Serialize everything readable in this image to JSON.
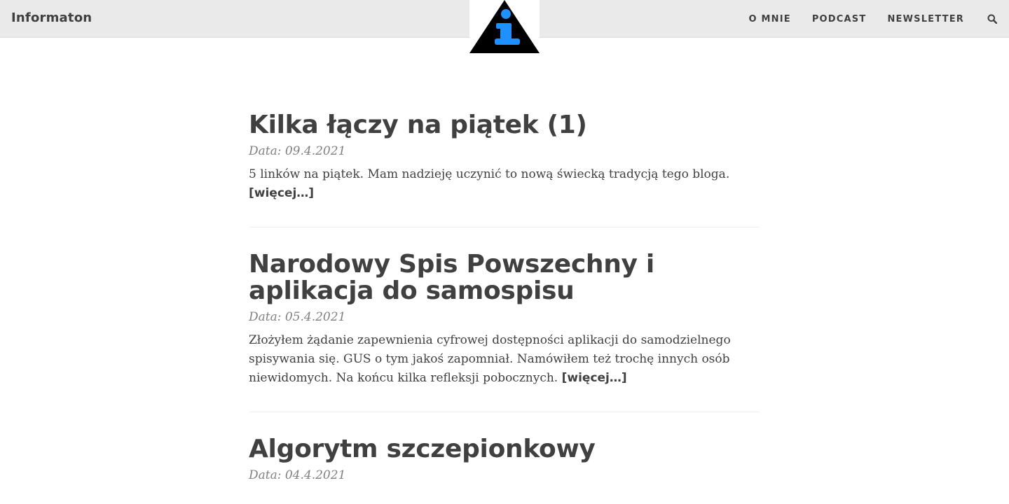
{
  "navbar": {
    "brand": "Informaton",
    "links": [
      {
        "label": "O MNIE"
      },
      {
        "label": "PODCAST"
      },
      {
        "label": "NEWSLETTER"
      }
    ],
    "search_icon": "search-icon",
    "logo_icon": "info-triangle-logo"
  },
  "colors": {
    "navbar_bg": "#eaeaea",
    "text": "#404040",
    "date": "#808080",
    "logo_accent": "#1e90ff"
  },
  "posts": [
    {
      "title": "Kilka łączy na piątek (1)",
      "date": "Data: 09.4.2021",
      "excerpt": "5 linków na piątek. Mam nadzieję uczynić to nową świecką tradycją tego bloga.",
      "more": "[więcej…]"
    },
    {
      "title": "Narodowy Spis Powszechny i aplikacja do samospisu",
      "date": "Data: 05.4.2021",
      "excerpt": "Złożyłem żądanie zapewnienia cyfrowej dostępności aplikacji do samodzielnego spisywania się. GUS o tym jakoś zapomniał. Namówiłem też trochę innych osób niewidomych. Na końcu kilka refleksji pobocznych.",
      "more": "[więcej…]"
    },
    {
      "title": "Algorytm szczepionkowy",
      "date": "Data: 04.4.2021",
      "excerpt": "",
      "more": ""
    }
  ]
}
